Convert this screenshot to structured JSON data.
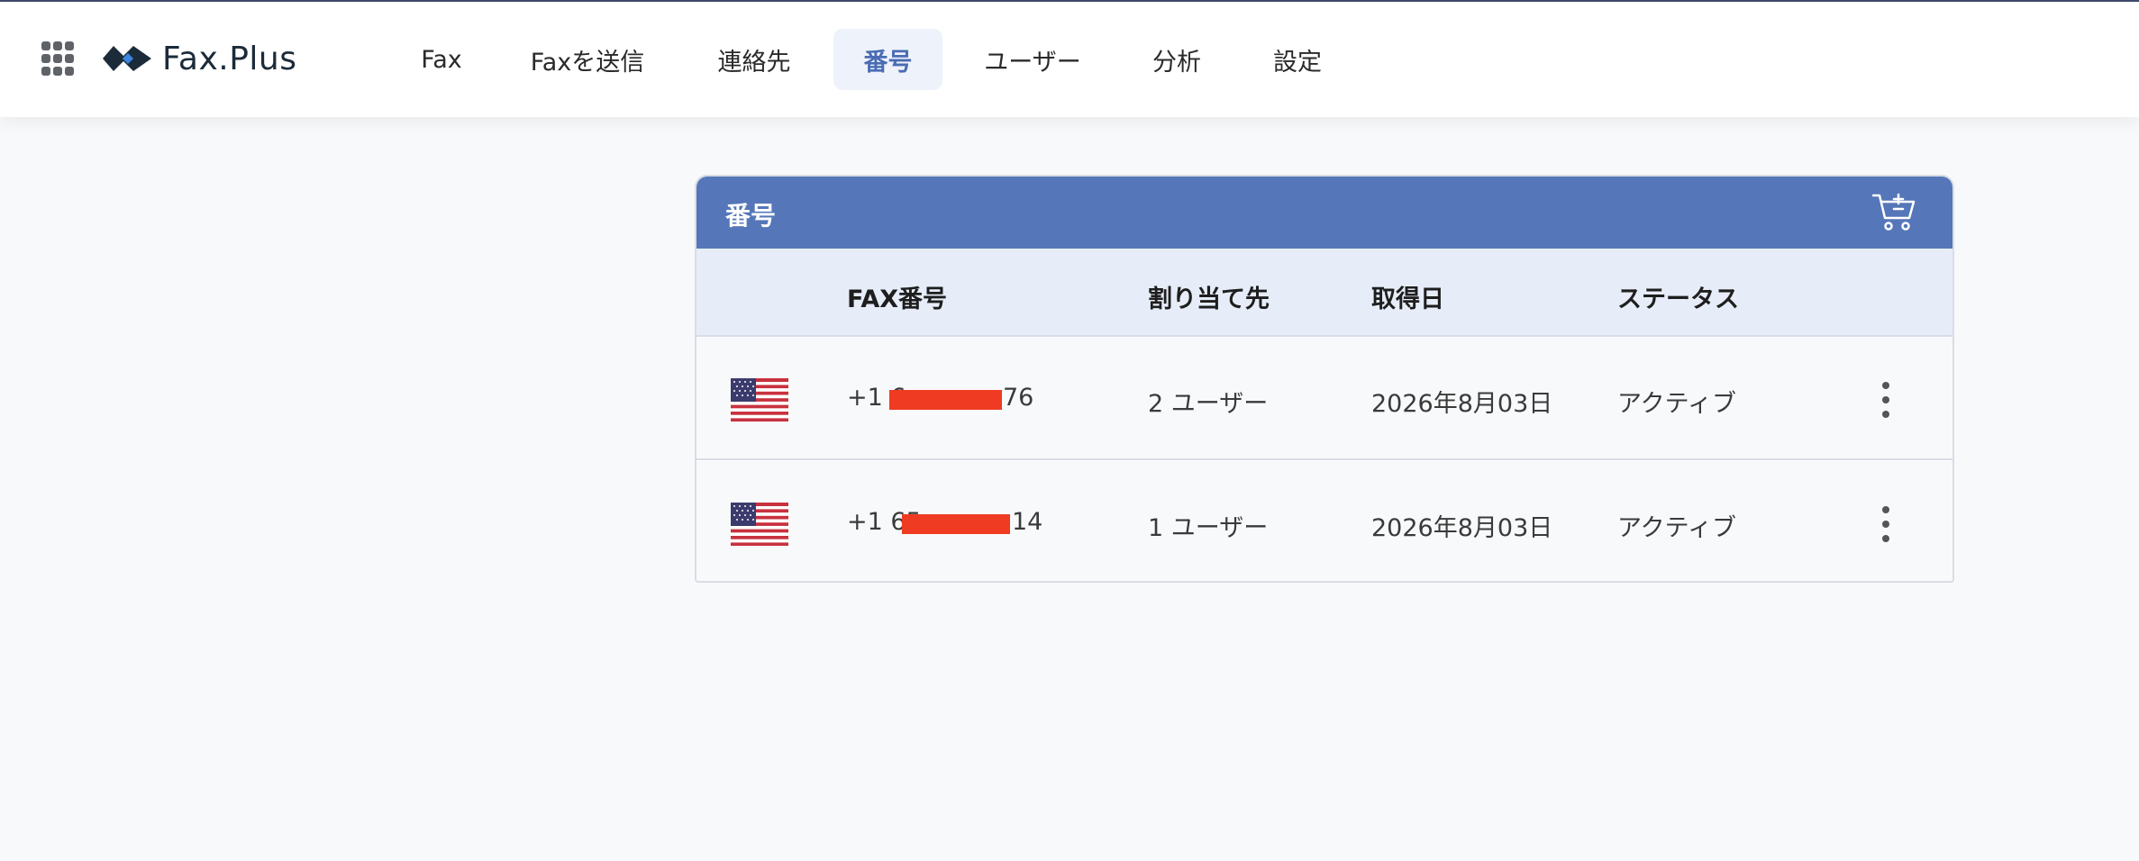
{
  "header": {
    "logo_text": "Fax.Plus",
    "nav": [
      {
        "label": "Fax"
      },
      {
        "label": "Faxを送信"
      },
      {
        "label": "連絡先"
      },
      {
        "label": "番号",
        "active": true
      },
      {
        "label": "ユーザー"
      },
      {
        "label": "分析"
      },
      {
        "label": "設定"
      }
    ]
  },
  "card": {
    "title": "番号",
    "columns": [
      "FAX番号",
      "割り当て先",
      "取得日",
      "ステータス"
    ],
    "rows": [
      {
        "flag": "us-flag",
        "number_prefix": "+1 6",
        "number_suffix": "76",
        "assigned": "2 ユーザー",
        "date": "2026年8月03日",
        "status": "アクティブ"
      },
      {
        "flag": "us-flag",
        "number_prefix": "+1 65",
        "number_suffix": "14",
        "assigned": "1 ユーザー",
        "date": "2026年8月03日",
        "status": "アクティブ"
      }
    ]
  },
  "icons": [
    "apps-grid-icon",
    "fax-plus-logo-icon",
    "add-to-cart-icon",
    "us-flag-icon",
    "more-vert-icon"
  ],
  "colors": {
    "accent": "#5577b9",
    "active_nav_bg": "#eef2fb",
    "redaction": "#ee3b22"
  }
}
